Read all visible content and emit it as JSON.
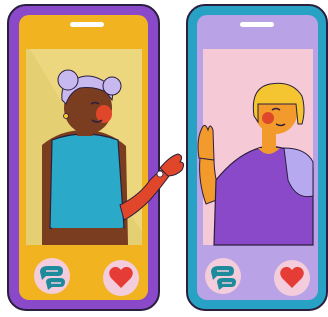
{
  "illustration": {
    "colors": {
      "background": "#ffffff",
      "outline": "#2a1f3d",
      "left_phone_frame": "#8a49c9",
      "left_phone_screen": "#f2b321",
      "left_phone_window": "#ecd67e",
      "left_phone_bottom_bar": "#f2b321",
      "right_phone_frame": "#27a1c4",
      "right_phone_screen": "#b9a3e6",
      "right_phone_window": "#f5c9d6",
      "chat_button_bg": "#f4cddc",
      "chat_icon": "#1e8b9c",
      "heart_button_bg": "#f4cddc",
      "heart_icon": "#e53c35",
      "woman_left_skin": "#7a3d1f",
      "woman_left_hair": "#c7b8ef",
      "woman_left_top": "#2aaac8",
      "woman_right_skin": "#f39a2d",
      "woman_right_hair": "#f5c531",
      "woman_right_top": "#8a49c9",
      "woman_right_sleeve": "#b7a9f0"
    },
    "left_phone": {
      "icons": [
        "chat-bubbles-icon",
        "heart-icon"
      ]
    },
    "right_phone": {
      "icons": [
        "chat-bubbles-icon",
        "heart-icon"
      ]
    }
  }
}
